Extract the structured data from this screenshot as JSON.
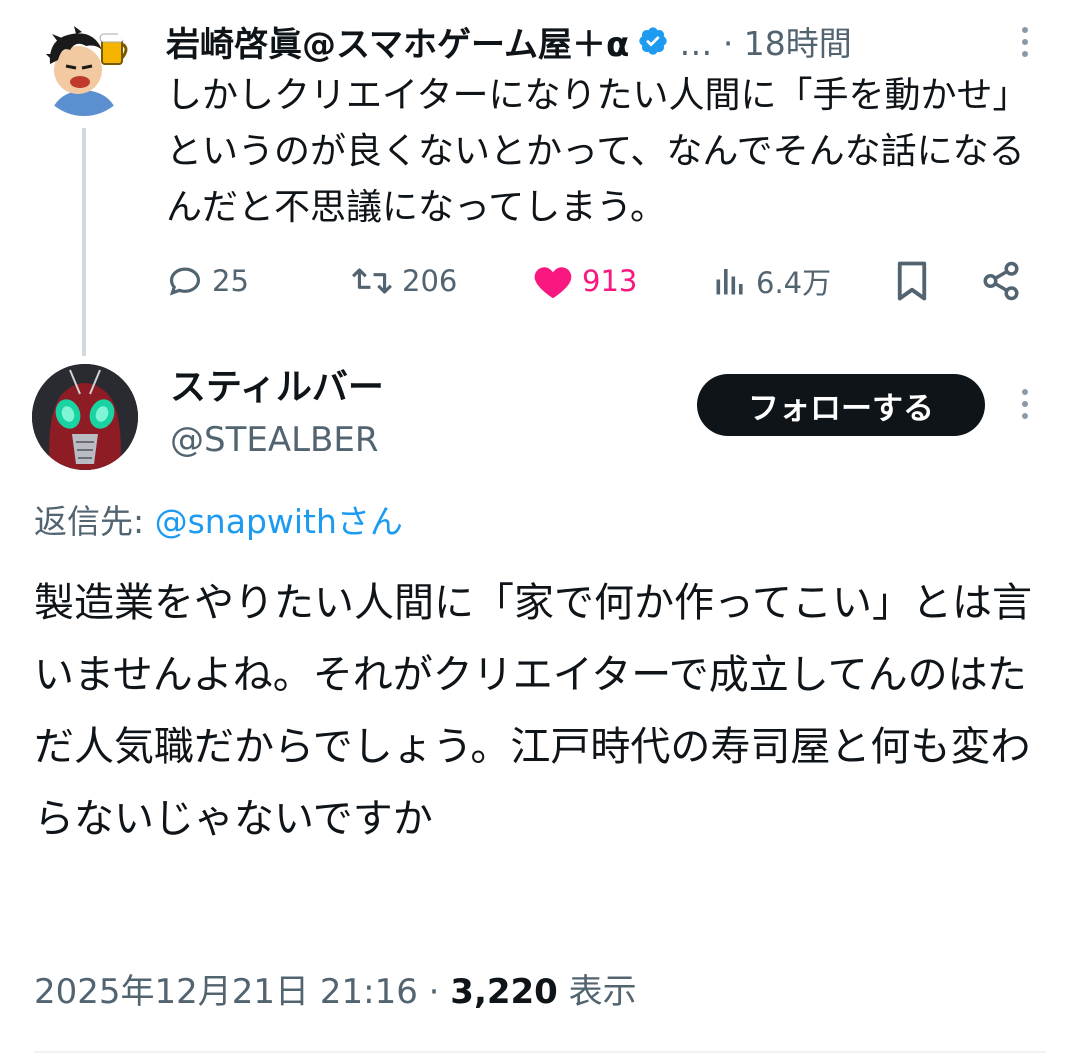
{
  "parent_tweet": {
    "author_name": "岩崎啓眞@スマホゲーム屋＋α",
    "meta": "… · 18時間",
    "text": "しかしクリエイターになりたい人間に「手を動かせ」というのが良くないとかって、なんでそんな話になるんだと不思議になってしまう。",
    "stats": {
      "replies": "25",
      "reposts": "206",
      "likes": "913",
      "views": "6.4万"
    },
    "icons": [
      "verified-badge-icon",
      "more-icon",
      "reply-icon",
      "repost-icon",
      "heart-icon",
      "views-icon",
      "bookmark-icon",
      "share-icon"
    ]
  },
  "reply_tweet": {
    "author_name": "スティルバー",
    "handle": "@STEALBER",
    "follow_label": "フォローする",
    "reply_to_label": "返信先: ",
    "reply_to_mention": "@snapwithさん",
    "text": "製造業をやりたい人間に「家で何か作ってこい」とは言いませんよね。それがクリエイターで成立してんのはただ人気職だからでしょう。江戸時代の寿司屋と何も変わらないじゃないですか",
    "timestamp": "2025年12月21日 21:16 · ",
    "views_count": "3,220",
    "views_label": " 表示"
  },
  "colors": {
    "text_primary": "#0f1419",
    "text_secondary": "#536471",
    "link_blue": "#1d9bf0",
    "like_pink": "#f91880",
    "divider": "#eff3f4"
  }
}
